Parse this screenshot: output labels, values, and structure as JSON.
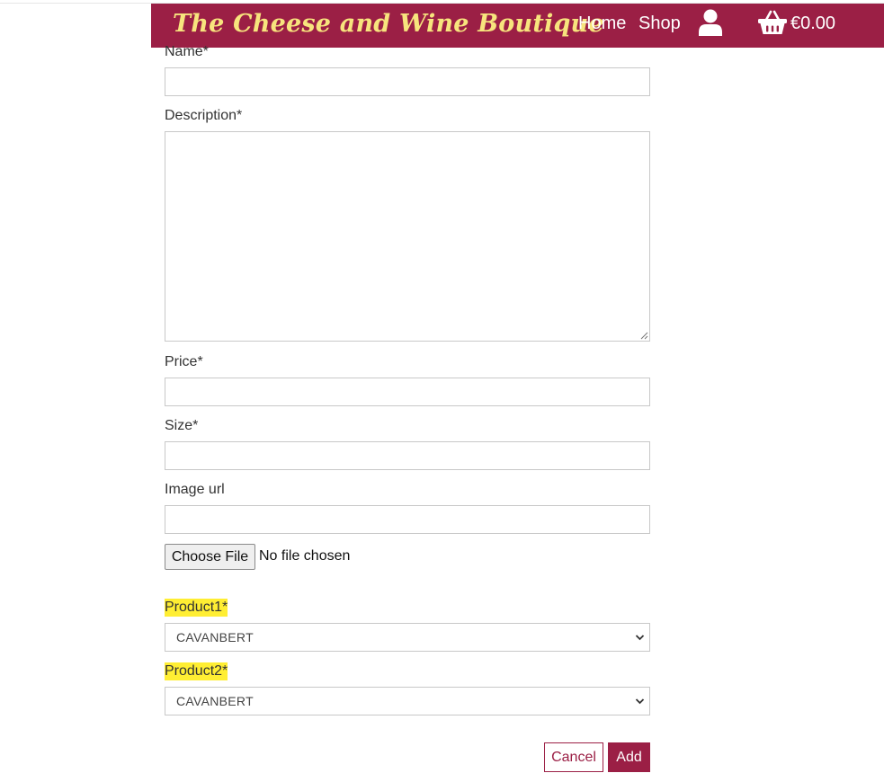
{
  "header": {
    "brand": "The Cheese and Wine Boutique",
    "nav": {
      "home": "Home",
      "shop": "Shop",
      "account_icon": "user-icon",
      "basket_icon": "basket-icon",
      "basket_total": "€0.00"
    }
  },
  "form": {
    "name": {
      "label": "Name*",
      "value": ""
    },
    "description": {
      "label": "Description*",
      "value": ""
    },
    "price": {
      "label": "Price*",
      "value": ""
    },
    "size": {
      "label": "Size*",
      "value": ""
    },
    "image_url": {
      "label": "Image url",
      "value": ""
    },
    "file": {
      "button_label": "Choose File",
      "status": "No file chosen"
    },
    "product1": {
      "label": "Product1*",
      "selected": "CAVANBERT"
    },
    "product2": {
      "label": "Product2*",
      "selected": "CAVANBERT"
    },
    "actions": {
      "cancel": "Cancel",
      "add": "Add"
    }
  },
  "colors": {
    "brand_bg": "#9b1f45",
    "brand_text": "#f7e47d",
    "highlight": "#ffee33"
  }
}
